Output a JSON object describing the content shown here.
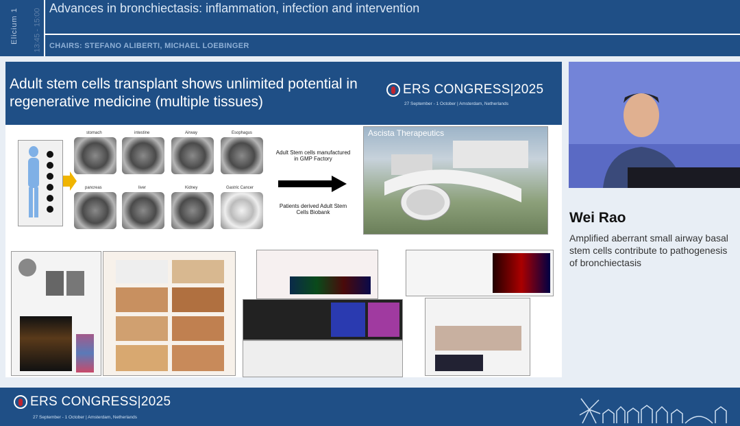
{
  "session": {
    "room": "Elicium 1",
    "time": "13:45 - 15:00",
    "title": "Advances in bronchiectasis: inflammation, infection and intervention",
    "chairs": "CHAIRS: STEFANO ALIBERTI, MICHAEL LOEBINGER"
  },
  "slide": {
    "title": "Adult stem cells transplant shows unlimited potential in regenerative medicine (multiple tissues)",
    "logo_text": "ERS CONGRESS|2025",
    "logo_sub": "27 September - 1 October | Amsterdam, Netherlands",
    "tissue_labels": [
      "stomach",
      "intestine",
      "Airway",
      "Esophagus",
      "pancreas",
      "liver",
      "Kidney",
      "Gastric Cancer"
    ],
    "factory_text": "Adult Stem cells manufactured in GMP Factory",
    "biobank_text": "Patients derived Adult Stem Cells Biobank",
    "company": "Ascista Therapeutics"
  },
  "speaker": {
    "name": "Wei Rao",
    "talk_title": "Amplified aberrant small airway basal stem cells contribute to pathogenesis of bronchiectasis"
  },
  "footer": {
    "logo_text": "ERS CONGRESS|2025",
    "logo_sub": "27 September - 1 October | Amsterdam, Netherlands"
  },
  "colors": {
    "brand_blue": "#1f4f86",
    "ers_red": "#c0242e"
  }
}
